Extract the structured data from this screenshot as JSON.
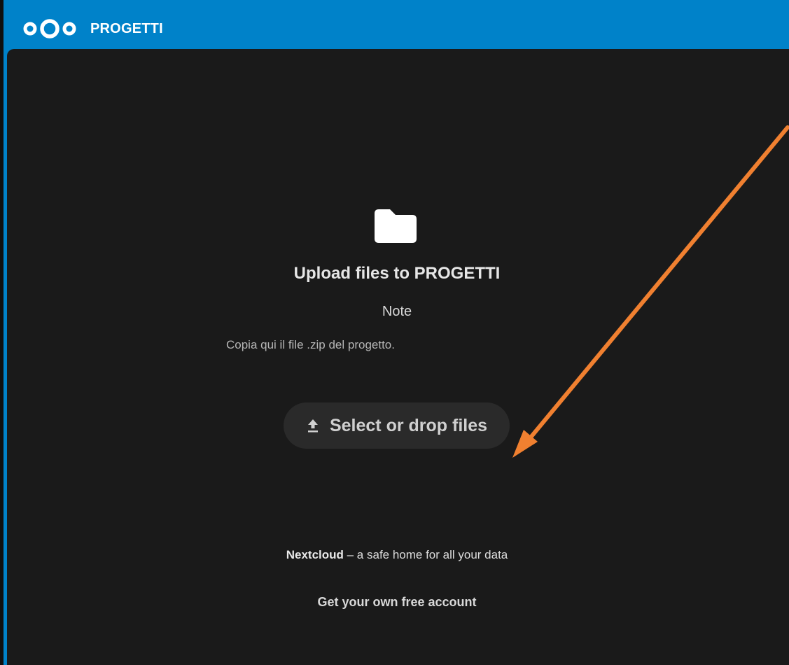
{
  "header": {
    "app_name": "PROGETTI",
    "logo_icon": "nextcloud-logo-icon",
    "background_color": "#0082c9"
  },
  "upload": {
    "folder_icon": "folder-icon",
    "title": "Upload files to PROGETTI",
    "note_heading": "Note",
    "note_text": "Copia qui il file .zip del progetto.",
    "button_icon": "upload-icon",
    "button_label": "Select or drop files"
  },
  "footer": {
    "brand": "Nextcloud",
    "tagline": " – a safe home for all your data",
    "signup_link": "Get your own free account"
  },
  "annotation": {
    "type": "arrow",
    "color": "#f08030",
    "points_to": "select-files-button"
  }
}
